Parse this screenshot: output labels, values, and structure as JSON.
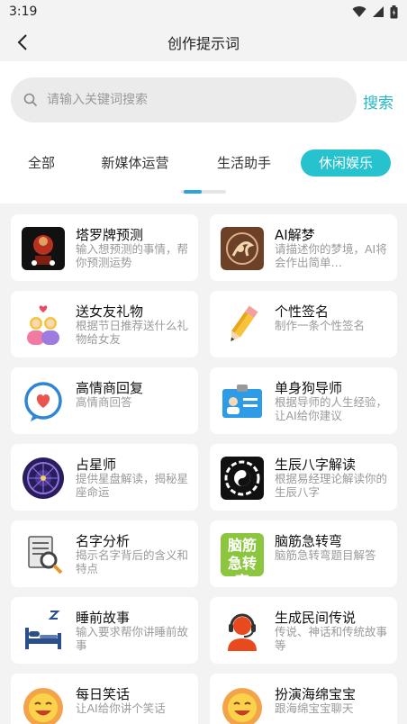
{
  "status_bar": {
    "time": "3:19"
  },
  "header": {
    "title": "创作提示词"
  },
  "search": {
    "placeholder": "请输入关键词搜索",
    "button_label": "搜索"
  },
  "tabs": [
    {
      "label": "全部",
      "active": false
    },
    {
      "label": "新媒体运营",
      "active": false
    },
    {
      "label": "生活助手",
      "active": false
    },
    {
      "label": "休闲娱乐",
      "active": true
    }
  ],
  "tab_scroll_position": 0.3,
  "cards": [
    {
      "title": "塔罗牌预测",
      "desc": "输入想预测的事情，帮你预测运势",
      "icon": "tarot-icon"
    },
    {
      "title": "AI解梦",
      "desc": "请描述你的梦境，AI将会作出简单…",
      "icon": "dream-icon"
    },
    {
      "title": "送女友礼物",
      "desc": "根据节日推荐送什么礼物给女友",
      "icon": "gift-couple-icon"
    },
    {
      "title": "个性签名",
      "desc": "制作一条个性签名",
      "icon": "pencil-icon"
    },
    {
      "title": "高情商回复",
      "desc": "高情商回答",
      "icon": "heart-chat-icon"
    },
    {
      "title": "单身狗导师",
      "desc": "根据导师的人生经验，让AI给你建议",
      "icon": "id-card-icon"
    },
    {
      "title": "占星师",
      "desc": "提供星盘解读，揭秘星座命运",
      "icon": "zodiac-icon"
    },
    {
      "title": "生辰八字解读",
      "desc": "根据易经理论解读你的生辰八字",
      "icon": "bagua-icon"
    },
    {
      "title": "名字分析",
      "desc": "揭示名字背后的含义和特点",
      "icon": "document-search-icon"
    },
    {
      "title": "脑筋急转弯",
      "desc": "脑筋急转弯题目解答",
      "icon": "brain-teaser-icon",
      "icon_text": "脑筋急转弯"
    },
    {
      "title": "睡前故事",
      "desc": "输入要求帮你讲睡前故事",
      "icon": "bed-icon"
    },
    {
      "title": "生成民间传说",
      "desc": "传说、神话和传统故事等",
      "icon": "headset-person-icon"
    },
    {
      "title": "每日笑话",
      "desc": "让AI给你讲个笑话",
      "icon": "laughing-sun-icon"
    },
    {
      "title": "扮演海绵宝宝",
      "desc": "跟海绵宝宝聊天",
      "icon": "sponge-sun-icon"
    }
  ]
}
